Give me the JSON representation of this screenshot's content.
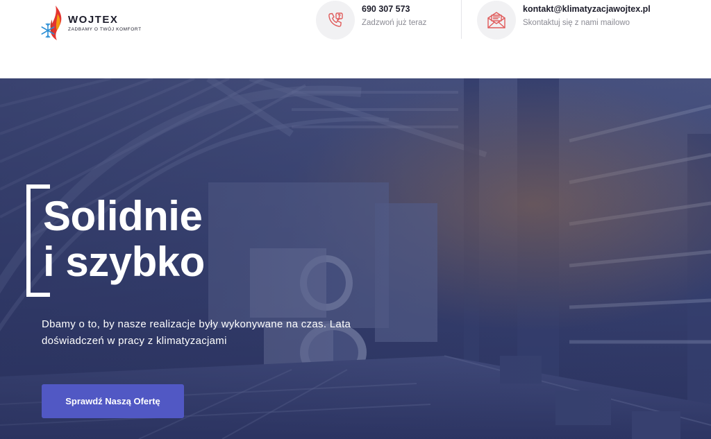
{
  "header": {
    "logo": {
      "name": "WOJTEX",
      "tagline": "ZADBAMY O TWÓJ KOMFORT"
    },
    "phone": {
      "icon": "phone-icon",
      "value": "690 307 573",
      "sub": "Zadzwoń już teraz"
    },
    "email": {
      "icon": "mail-icon",
      "value": "kontakt@klimatyzacjawojtex.pl",
      "sub": "Skontaktuj się z nami mailowo"
    }
  },
  "hero": {
    "title_line1": "Solidnie",
    "title_line2": "i szybko",
    "description": "Dbamy o to, by nasze realizacje były wykonywane na czas. Lata doświadczeń w pracy z klimatyzacjami",
    "button_label": "Sprawdź Naszą Ofertę"
  },
  "colors": {
    "accent": "#5158c4",
    "logo_red": "#e3342f",
    "logo_orange": "#f39c12",
    "logo_blue": "#2d8fd5",
    "icon_red": "#e05a5a",
    "hero_tint": "#2a3560"
  }
}
